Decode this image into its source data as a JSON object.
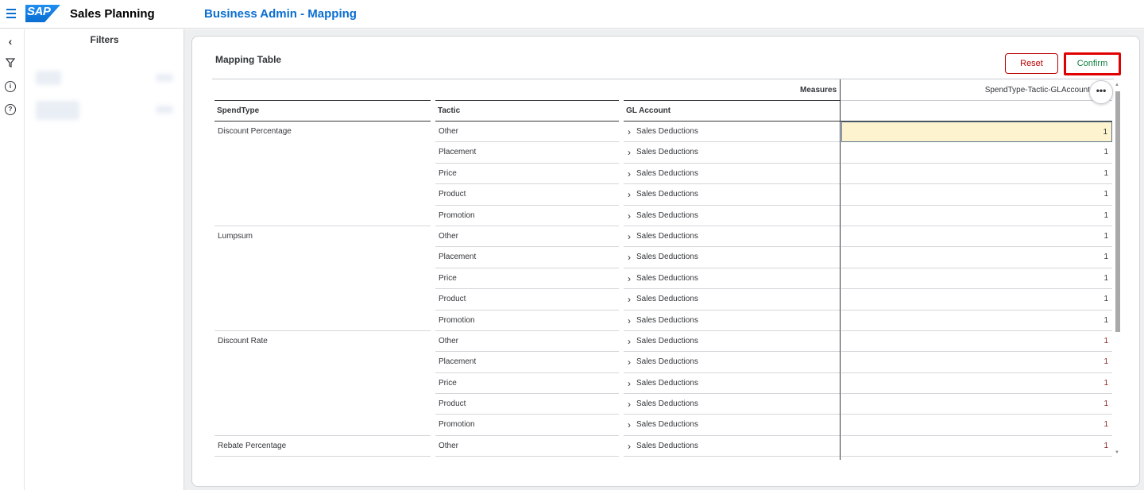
{
  "shell": {
    "logo": "SAP",
    "app_title": "Sales Planning",
    "page_title": "Business Admin - Mapping"
  },
  "rail": {
    "icons": [
      "collapse-icon",
      "filter-icon",
      "info-icon",
      "help-icon"
    ]
  },
  "filters": {
    "title": "Filters"
  },
  "card": {
    "title": "Mapping Table",
    "reset_label": "Reset",
    "confirm_label": "Confirm",
    "more_label": "•••"
  },
  "table": {
    "measures_label": "Measures",
    "measure_name": "SpendType-Tactic-GLAccount",
    "columns": {
      "spend_type": "SpendType",
      "tactic": "Tactic",
      "gl_account": "GL Account"
    },
    "rows": [
      {
        "spend_type": "Discount Percentage",
        "tactic": "Other",
        "gl_account": "Sales Deductions",
        "value": "1"
      },
      {
        "spend_type": "",
        "tactic": "Placement",
        "gl_account": "Sales Deductions",
        "value": "1"
      },
      {
        "spend_type": "",
        "tactic": "Price",
        "gl_account": "Sales Deductions",
        "value": "1"
      },
      {
        "spend_type": "",
        "tactic": "Product",
        "gl_account": "Sales Deductions",
        "value": "1"
      },
      {
        "spend_type": "",
        "tactic": "Promotion",
        "gl_account": "Sales Deductions",
        "value": "1"
      },
      {
        "spend_type": "Lumpsum",
        "tactic": "Other",
        "gl_account": "Sales Deductions",
        "value": "1"
      },
      {
        "spend_type": "",
        "tactic": "Placement",
        "gl_account": "Sales Deductions",
        "value": "1"
      },
      {
        "spend_type": "",
        "tactic": "Price",
        "gl_account": "Sales Deductions",
        "value": "1"
      },
      {
        "spend_type": "",
        "tactic": "Product",
        "gl_account": "Sales Deductions",
        "value": "1"
      },
      {
        "spend_type": "",
        "tactic": "Promotion",
        "gl_account": "Sales Deductions",
        "value": "1"
      },
      {
        "spend_type": "Discount Rate",
        "tactic": "Other",
        "gl_account": "Sales Deductions",
        "value": "1"
      },
      {
        "spend_type": "",
        "tactic": "Placement",
        "gl_account": "Sales Deductions",
        "value": "1"
      },
      {
        "spend_type": "",
        "tactic": "Price",
        "gl_account": "Sales Deductions",
        "value": "1"
      },
      {
        "spend_type": "",
        "tactic": "Product",
        "gl_account": "Sales Deductions",
        "value": "1"
      },
      {
        "spend_type": "",
        "tactic": "Promotion",
        "gl_account": "Sales Deductions",
        "value": "1"
      },
      {
        "spend_type": "Rebate Percentage",
        "tactic": "Other",
        "gl_account": "Sales Deductions",
        "value": "1"
      }
    ]
  }
}
